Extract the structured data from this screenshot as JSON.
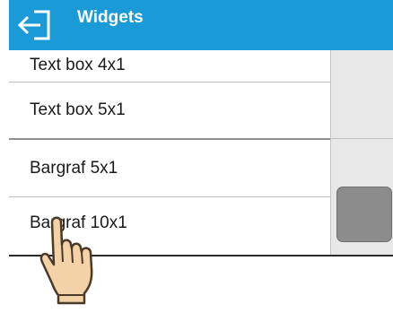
{
  "header": {
    "title": "Widgets",
    "back_icon": "back-arrow-icon",
    "color": "#1a9ad6"
  },
  "list": {
    "items": [
      {
        "label": "Text box 4x1"
      },
      {
        "label": "Text box 5x1"
      },
      {
        "label": "Bargraf 5x1"
      },
      {
        "label": "Bargraf 10x1"
      }
    ]
  },
  "scrollbar": {
    "thumb_color": "#8c8c8c"
  },
  "pointer": {
    "icon": "hand-pointer-icon"
  }
}
